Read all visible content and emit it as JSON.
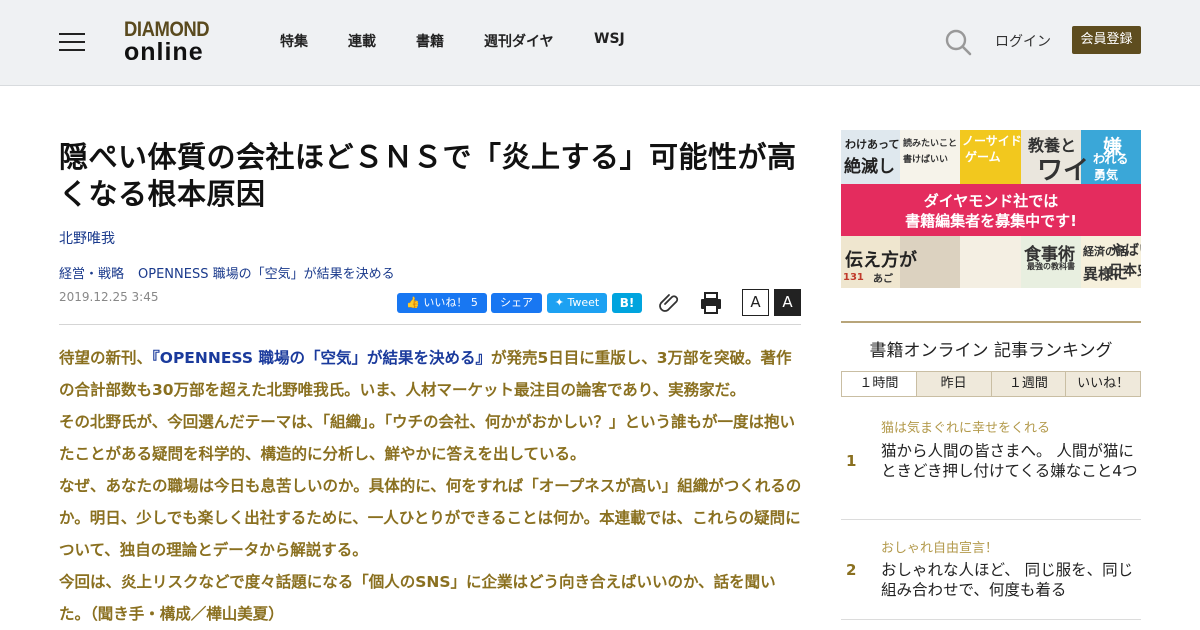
{
  "header": {
    "logo_line1": "DIAMOND",
    "logo_line2": "online",
    "nav": [
      "特集",
      "連載",
      "書籍",
      "週刊ダイヤ",
      "WSJ"
    ],
    "login_label": "ログイン",
    "register_label": "会員登録"
  },
  "article": {
    "title": "隠ぺい体質の会社ほどＳＮＳで「炎上する」可能性が高くなる根本原因",
    "author": "北野唯我",
    "categories": [
      "経営・戦略",
      "OPENNESS 職場の「空気」が結果を決める"
    ],
    "date": "2019.12.25 3:45",
    "share": {
      "like_label": "いいね！ 5",
      "share_label": "シェア",
      "tweet_label": "Tweet",
      "hatena_label": "B!"
    },
    "font_small_label": "A",
    "font_large_label": "A",
    "lead_p1_before": "待望の新刊、",
    "lead_p1_link": "『OPENNESS 職場の「空気」が結果を決める』",
    "lead_p1_after": "が発売5日目に重版し、3万部を突破。著作の合計部数も30万部を超えた北野唯我氏。いま、人材マーケット最注目の論客であり、実務家だ。",
    "lead_p2": "その北野氏が、今回選んだテーマは、「組織」。「ウチの会社、何かがおかしい？」という誰もが一度は抱いたことがある疑問を科学的、構造的に分析し、鮮やかに答えを出している。",
    "lead_p3": "なぜ、あなたの職場は今日も息苦しいのか。具体的に、何をすれば「オープネスが高い」組織がつくれるのか。明日、少しでも楽しく出社するために、一人ひとりができることは何か。本連載では、これらの疑問について、独自の理論とデータから解説する。",
    "lead_p4": "今回は、炎上リスクなどで度々話題になる「個人のSNS」に企業はどう向き合えばいいのか、話を聞いた。（聞き手・構成／樺山美夏）"
  },
  "sidebar": {
    "banner": {
      "line1": "ダイヤモンド社では",
      "line2": "書籍編集者を募集中です!",
      "tiles": [
        "嫌",
        "われる",
        "勇気",
        "教養と",
        "ワイ",
        "ノーサイド",
        "ゲーム",
        "読みたいこと",
        "書けばいい",
        "絶滅し",
        "わけあって",
        "食事術",
        "最強の教科書",
        "経済の話",
        "異様に",
        "伝え方が",
        "やばい",
        "日本史",
        "あご",
        "131"
      ]
    },
    "ranking": {
      "title": "書籍オンライン 記事ランキング",
      "tabs": [
        "１時間",
        "昨日",
        "１週間",
        "いいね！"
      ],
      "items": [
        {
          "rank": "1",
          "category": "猫は気まぐれに幸せをくれる",
          "title": "猫から人間の皆さまへ。 人間が猫にときどき押し付けてくる嫌なこと4つ"
        },
        {
          "rank": "2",
          "category": "おしゃれ自由宣言！",
          "title": "おしゃれな人ほど、 同じ服を、同じ組み合わせで、何度も着る"
        }
      ]
    }
  },
  "colors": {
    "header_bg": "#eff1f3",
    "register_bg": "#5e4d1f",
    "lead_text": "#8a7020",
    "link": "#1a3a8c",
    "banner_pink": "#e42c5e"
  }
}
